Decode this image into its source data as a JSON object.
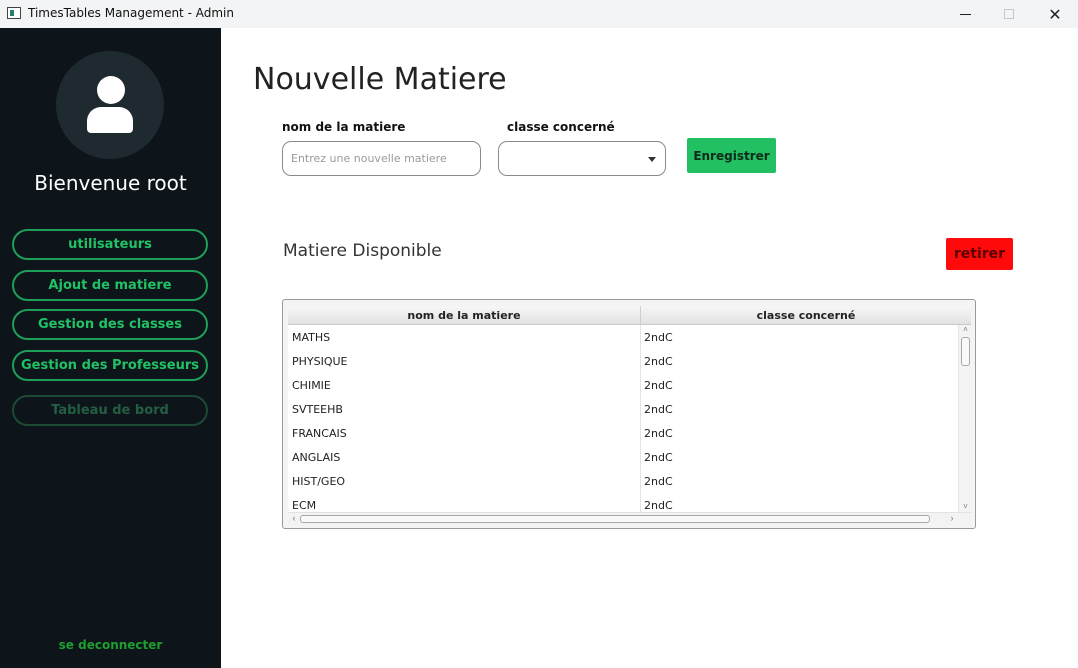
{
  "window": {
    "title": "TimesTables Management - Admin"
  },
  "sidebar": {
    "welcome": "Bienvenue root",
    "nav": {
      "users": "utilisateurs",
      "add_subject": "Ajout de matiere",
      "classes": "Gestion des classes",
      "teachers": "Gestion des Professeurs",
      "dashboard": "Tableau de bord"
    },
    "logout": "se deconnecter"
  },
  "main": {
    "title": "Nouvelle Matiere",
    "subject_label": "nom de la matiere",
    "subject_placeholder": "Entrez une nouvelle matiere",
    "class_label": "classe concerné",
    "class_value": "",
    "save_label": "Enregistrer",
    "section_title": "Matiere Disponible",
    "remove_label": "retirer"
  },
  "table": {
    "columns": [
      "nom de la matiere",
      "classe concerné"
    ],
    "rows": [
      [
        "MATHS",
        "2ndC"
      ],
      [
        "PHYSIQUE",
        "2ndC"
      ],
      [
        "CHIMIE",
        "2ndC"
      ],
      [
        "SVTEEHB",
        "2ndC"
      ],
      [
        "FRANCAIS",
        "2ndC"
      ],
      [
        "ANGLAIS",
        "2ndC"
      ],
      [
        "HIST/GEO",
        "2ndC"
      ],
      [
        "ECM",
        "2ndC"
      ]
    ]
  },
  "colors": {
    "sidebar_bg": "#0d141a",
    "accent_green": "#22c063",
    "danger_red": "#ff0a0a"
  }
}
